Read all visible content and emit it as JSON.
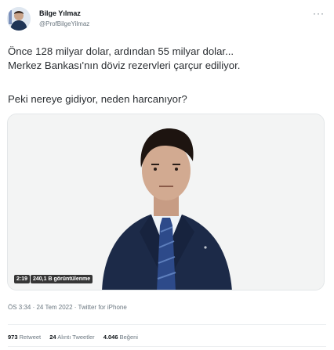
{
  "author": {
    "name": "Bilge Yılmaz",
    "handle": "@ProfBilgeYilmaz"
  },
  "tweet": {
    "line1": "Önce 128 milyar dolar, ardından 55 milyar dolar...",
    "line2": "Merkez Bankası'nın döviz rezervleri çarçur ediliyor.",
    "line3": "Peki nereye gidiyor, neden harcanıyor?"
  },
  "video": {
    "duration": "2:19",
    "views": "240,1 B görüntülenme"
  },
  "meta": {
    "timestamp": "ÖS 3:34 · 24 Tem 2022 · Twitter for iPhone"
  },
  "stats": {
    "retweets_num": "973",
    "retweets_label": "Retweet",
    "quotes_num": "24",
    "quotes_label": "Alıntı Tweetler",
    "likes_num": "4.046",
    "likes_label": "Beğeni"
  },
  "icons": {
    "more": "more-icon"
  }
}
